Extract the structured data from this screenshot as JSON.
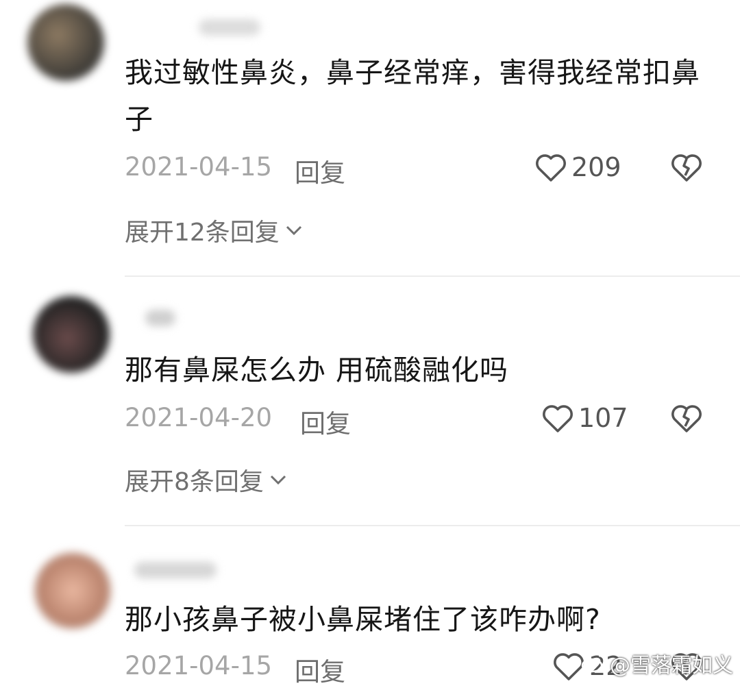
{
  "comments": [
    {
      "text": "我过敏性鼻炎，鼻子经常痒，害得我经常扣鼻子",
      "date": "2021-04-15",
      "reply_label": "回复",
      "likes": "209",
      "expand_label": "展开12条回复"
    },
    {
      "text": "那有鼻屎怎么办 用硫酸融化吗",
      "date": "2021-04-20",
      "reply_label": "回复",
      "likes": "107",
      "expand_label": "展开8条回复"
    },
    {
      "text": "那小孩鼻子被小鼻屎堵住了该咋办啊?",
      "date": "2021-04-15",
      "reply_label": "回复",
      "likes": "22"
    }
  ],
  "watermark": "@雪落霜如义",
  "colors": {
    "text": "#161616",
    "meta": "#a6a6a6",
    "icon": "#555555"
  },
  "icons": {
    "like": "heart-outline-icon",
    "dislike": "broken-heart-icon",
    "expand": "chevron-down-icon",
    "watermark": "weibo-logo-icon"
  }
}
